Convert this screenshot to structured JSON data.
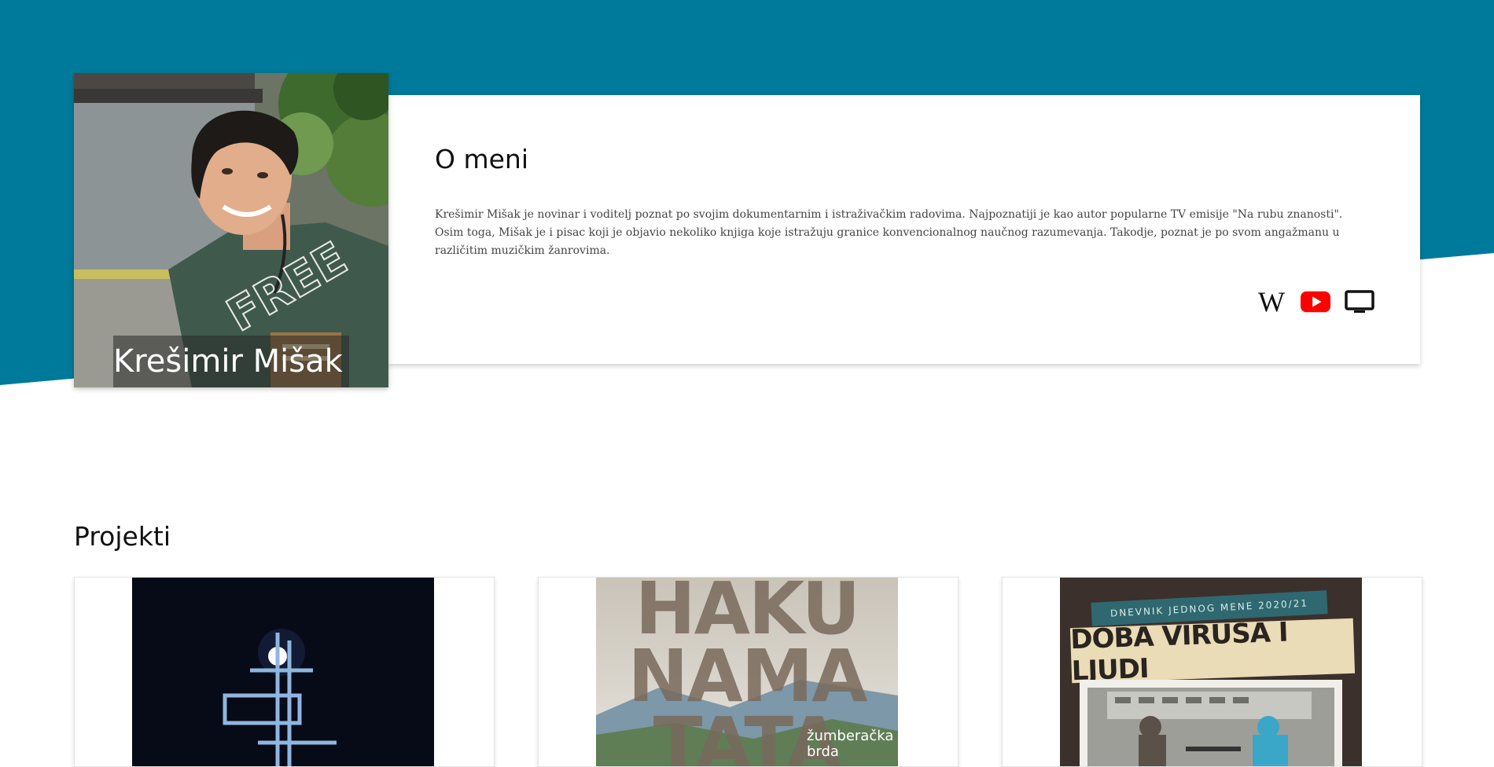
{
  "profile": {
    "name": "Krešimir Mišak"
  },
  "about": {
    "title": "O meni",
    "text": "Krešimir Mišak je novinar i voditelj poznat po svojim dokumentarnim i istraživačkim radovima. Najpoznatiji je kao autor popularne TV emisije \"Na rubu znanosti\". Osim toga, Mišak je i pisac koji je objavio nekoliko knjiga koje istražuju granice konvencionalnog naučnog razumevanja. Takodje, poznat je po svom angažmanu u različitim muzičkim žanrovima.",
    "links": [
      {
        "icon": "wikipedia-icon",
        "glyph": "W"
      },
      {
        "icon": "youtube-icon",
        "color": "#ff0000"
      },
      {
        "icon": "tv-icon"
      }
    ]
  },
  "projects": {
    "title": "Projekti",
    "items": [
      {
        "cover": "dark-cover-with-light-symbol"
      },
      {
        "cover_lines": [
          "HAKU",
          "NAMA",
          "TATA"
        ],
        "cover_subtitle": "žumberačka brda"
      },
      {
        "cover_strip": "DNEVNIK JEDNOG MENE 2020/21",
        "cover_title": "DOBA VIRUSA I LJUDI"
      }
    ]
  },
  "colors": {
    "hero": "#007a9a",
    "youtube": "#ff0000"
  }
}
